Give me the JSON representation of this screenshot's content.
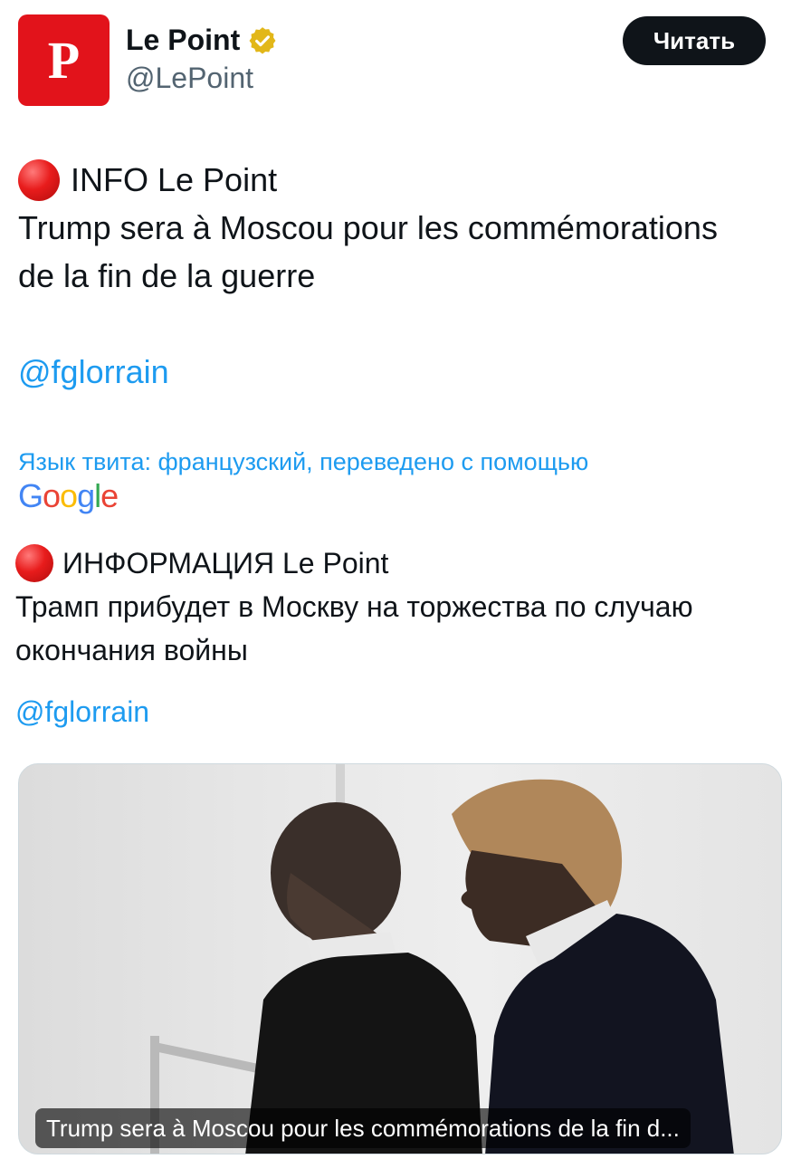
{
  "account": {
    "display_name": "Le Point",
    "handle": "@LePoint",
    "avatar_letter": "P",
    "brand_color": "#e2131b",
    "verified_badge_color": "#e2b719"
  },
  "follow_button": {
    "label": "Читать"
  },
  "tweet": {
    "line1": "INFO Le Point",
    "line2": "Trump sera à Moscou pour les commémorations",
    "line3": "de la fin de la guerre",
    "mention": "@fglorrain"
  },
  "translation": {
    "note": "Язык твита: французский, переведено с помощью",
    "provider_letters": [
      "G",
      "o",
      "o",
      "g",
      "l",
      "e"
    ],
    "line1": "ИНФОРМАЦИЯ Le Point",
    "line2": "Трамп прибудет в Москву на торжества по случаю",
    "line3": "окончания войны",
    "mention": "@fglorrain"
  },
  "media": {
    "caption": "Trump sera à Moscou pour les commémorations de la fin d..."
  },
  "colors": {
    "link": "#1d9bf0",
    "text": "#0f1419",
    "secondary": "#536471",
    "button_bg": "#0f1419"
  }
}
